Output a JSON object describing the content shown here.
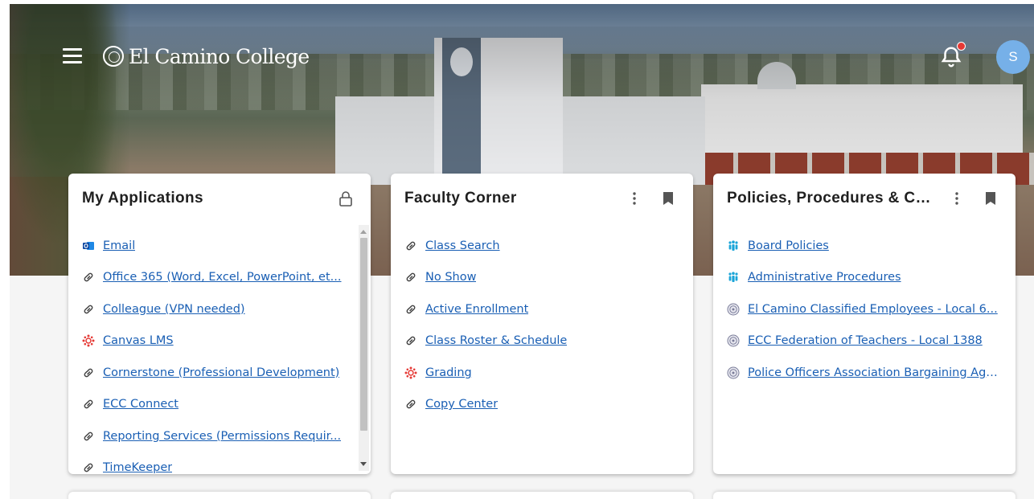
{
  "header": {
    "brand": "El Camino College",
    "avatar_initial": "S",
    "colors": {
      "avatar_bg": "#76b0e8",
      "notification_dot": "#e53935",
      "link": "#1a5fb4"
    }
  },
  "cards": [
    {
      "title": "My Applications",
      "actions": [
        "lock-icon"
      ],
      "links": [
        {
          "label": "Email",
          "icon": "outlook-icon"
        },
        {
          "label": "Office 365 (Word, Excel, PowerPoint, et...",
          "icon": "link-icon"
        },
        {
          "label": "Colleague (VPN needed)",
          "icon": "link-icon"
        },
        {
          "label": "Canvas LMS",
          "icon": "canvas-icon"
        },
        {
          "label": "Cornerstone (Professional Development)",
          "icon": "link-icon"
        },
        {
          "label": "ECC Connect",
          "icon": "link-icon"
        },
        {
          "label": "Reporting Services (Permissions Requir...",
          "icon": "link-icon"
        },
        {
          "label": "TimeKeeper",
          "icon": "link-icon"
        }
      ]
    },
    {
      "title": "Faculty Corner",
      "actions": [
        "more-vert-icon",
        "bookmark-icon"
      ],
      "links": [
        {
          "label": "Class Search",
          "icon": "link-icon"
        },
        {
          "label": "No Show",
          "icon": "link-icon"
        },
        {
          "label": "Active Enrollment",
          "icon": "link-icon"
        },
        {
          "label": "Class Roster & Schedule",
          "icon": "link-icon"
        },
        {
          "label": "Grading",
          "icon": "canvas-icon"
        },
        {
          "label": "Copy Center",
          "icon": "link-icon"
        }
      ]
    },
    {
      "title": "Policies, Procedures & Co...",
      "actions": [
        "more-vert-icon",
        "bookmark-icon"
      ],
      "links": [
        {
          "label": "Board Policies",
          "icon": "people-icon"
        },
        {
          "label": "Administrative Procedures",
          "icon": "people-icon"
        },
        {
          "label": "El Camino Classified Employees - Local 6...",
          "icon": "seal-icon"
        },
        {
          "label": "ECC Federation of Teachers - Local 1388",
          "icon": "seal-icon"
        },
        {
          "label": "Police Officers Association Bargaining Agr...",
          "icon": "seal-icon"
        }
      ]
    }
  ]
}
